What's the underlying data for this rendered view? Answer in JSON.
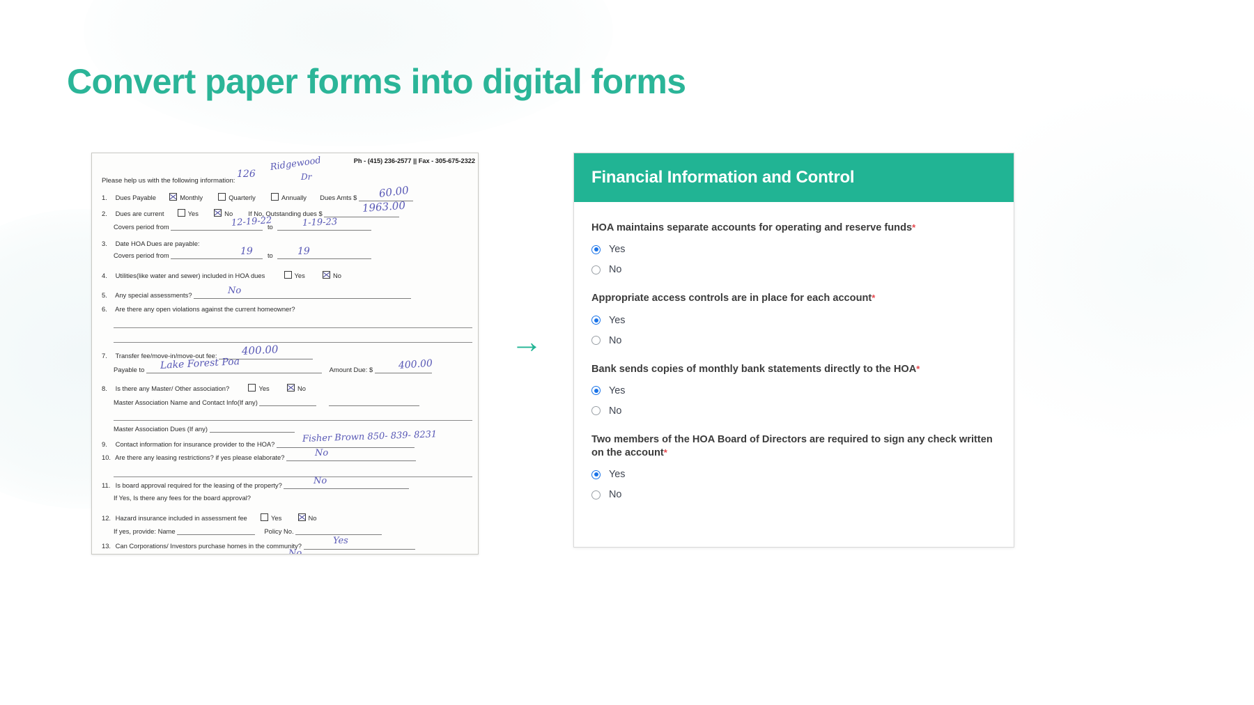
{
  "heading": "Convert paper forms into digital forms",
  "arrow": "→",
  "paper_form": {
    "contact_line": "Ph - (415) 236-2577 || Fax - 305-675-2322",
    "intro": "Please help us with the following information:",
    "handwriting": {
      "address_number": "126",
      "address_street": "Ridgewood",
      "address_suffix": "Dr",
      "dues_amount": "60.00",
      "outstanding_dues": "1963.00",
      "covers_from_1": "12-19-22",
      "covers_to_1": "1-19-23",
      "covers_from_2": "19",
      "covers_to_2": "19",
      "special_assessments": "No",
      "transfer_fee": "400.00",
      "payable_to": "Lake Forest Poa",
      "amount_due": "400.00",
      "insurance_provider": "Fisher Brown  850- 839- 8231",
      "leasing_restrictions": "No",
      "board_approval": "No",
      "corporations_purchase": "Yes",
      "corporations_purchase_2": "No"
    },
    "items": [
      {
        "num": "1.",
        "label": "Dues Payable",
        "checkboxes": [
          {
            "label": "Monthly",
            "checked": true
          },
          {
            "label": "Quarterly",
            "checked": false
          },
          {
            "label": "Annually",
            "checked": false
          }
        ],
        "trailing": "Dues Amts $"
      },
      {
        "num": "2.",
        "label": "Dues are current",
        "checkboxes": [
          {
            "label": "Yes",
            "checked": false
          },
          {
            "label": "No",
            "checked": true
          }
        ],
        "trailing": "If No, Outstanding dues $",
        "sub": "Covers period from"
      },
      {
        "num": "3.",
        "label": "Date HOA Dues are payable:",
        "sub": "Covers period from"
      },
      {
        "num": "4.",
        "label": "Utilities(like water and sewer) included in HOA dues",
        "checkboxes": [
          {
            "label": "Yes",
            "checked": false
          },
          {
            "label": "No",
            "checked": true
          }
        ]
      },
      {
        "num": "5.",
        "label": "Any special assessments?"
      },
      {
        "num": "6.",
        "label": "Are there any open violations against the current homeowner?"
      },
      {
        "num": "7.",
        "label": "Transfer fee/move-in/move-out fee:",
        "sub": "Payable to",
        "trailing": "Amount Due: $"
      },
      {
        "num": "8.",
        "label": "Is there any Master/ Other association?",
        "checkboxes": [
          {
            "label": "Yes",
            "checked": false
          },
          {
            "label": "No",
            "checked": true
          }
        ],
        "sub": "Master Association Name and Contact Info(If any)",
        "sub2": "Master Association Dues (If any)"
      },
      {
        "num": "9.",
        "label": "Contact information for insurance provider to the HOA?"
      },
      {
        "num": "10.",
        "label": "Are there any leasing restrictions? if yes please elaborate?"
      },
      {
        "num": "11.",
        "label": "Is board approval required for the leasing of the property?",
        "sub": "If Yes, Is there any fees for the board approval?"
      },
      {
        "num": "12.",
        "label": "Hazard insurance included in assessment fee",
        "checkboxes": [
          {
            "label": "Yes",
            "checked": false
          },
          {
            "label": "No",
            "checked": true
          }
        ],
        "sub": "If yes, provide: Name",
        "sub_trailing": "Policy No."
      },
      {
        "num": "13.",
        "label": "Can Corporations/ Investors purchase homes in the community?"
      }
    ]
  },
  "digital_form": {
    "header_title": "Financial Information and Control",
    "required_marker": "*",
    "questions": [
      {
        "label": "HOA maintains separate accounts for operating and reserve funds",
        "required": true,
        "options": [
          {
            "label": "Yes",
            "selected": true
          },
          {
            "label": "No",
            "selected": false
          }
        ]
      },
      {
        "label": "Appropriate access controls are in place for each account",
        "required": true,
        "options": [
          {
            "label": "Yes",
            "selected": true
          },
          {
            "label": "No",
            "selected": false
          }
        ]
      },
      {
        "label": "Bank sends copies of monthly bank statements directly to the HOA",
        "required": true,
        "options": [
          {
            "label": "Yes",
            "selected": true
          },
          {
            "label": "No",
            "selected": false
          }
        ]
      },
      {
        "label": "Two members of the HOA Board of Directors are required to sign any check written on the account",
        "required": true,
        "options": [
          {
            "label": "Yes",
            "selected": true
          },
          {
            "label": "No",
            "selected": false
          }
        ]
      }
    ]
  },
  "colors": {
    "brand_teal": "#21b494",
    "title_teal": "#2bb598",
    "radio_blue": "#1a73e8",
    "required_red": "#e5484d",
    "ink_blue": "#4a4ab0"
  }
}
